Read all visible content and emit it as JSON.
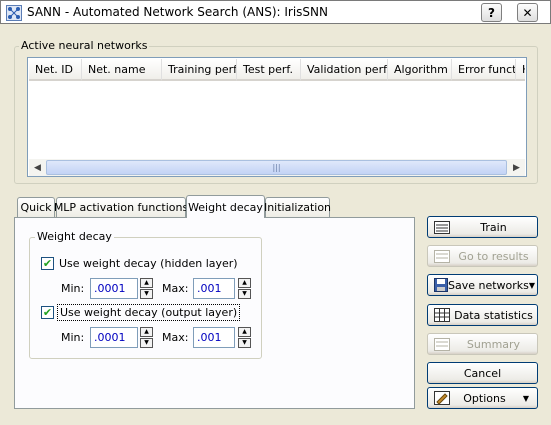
{
  "window": {
    "title": "SANN - Automated Network Search (ANS): IrisSNN",
    "help_button": "?",
    "close_button": "✕"
  },
  "networks_group": {
    "label": "Active neural networks",
    "columns": [
      "Net. ID",
      "Net. name",
      "Training perf.",
      "Test perf.",
      "Validation perf.",
      "Algorithm",
      "Error funct.",
      "H"
    ],
    "rows": []
  },
  "tabs": [
    {
      "label": "Quick",
      "active": false
    },
    {
      "label": "MLP activation functions",
      "active": false
    },
    {
      "label": "Weight decay",
      "active": true
    },
    {
      "label": "Initialization",
      "active": false
    }
  ],
  "weight_decay": {
    "group_label": "Weight decay",
    "hidden": {
      "label": "Use weight decay (hidden layer)",
      "checked": true,
      "min_label": "Min:",
      "min_value": ".0001",
      "max_label": "Max:",
      "max_value": ".001"
    },
    "output": {
      "label": "Use weight decay (output layer)",
      "checked": true,
      "min_label": "Min:",
      "min_value": ".0001",
      "max_label": "Max:",
      "max_value": ".001"
    }
  },
  "buttons": {
    "train": "Train",
    "go_to_results": "Go to results",
    "save_networks": "Save networks",
    "data_statistics": "Data statistics",
    "summary": "Summary",
    "cancel": "Cancel",
    "options": "Options"
  },
  "colors": {
    "face": "#ece9d8",
    "input_text": "#0000c0",
    "check": "#21a121",
    "border_blue": "#7f9db9"
  }
}
